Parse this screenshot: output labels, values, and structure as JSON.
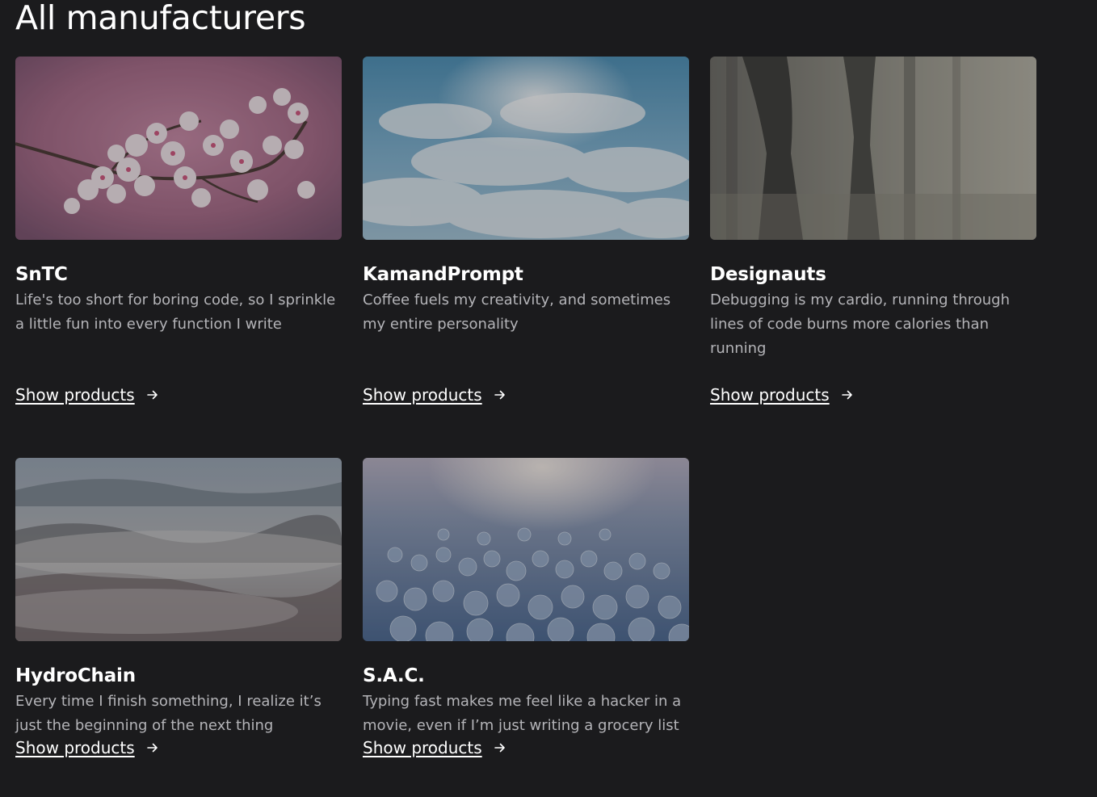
{
  "page": {
    "title": "All manufacturers"
  },
  "manufacturers": [
    {
      "name": "SnTC",
      "description": "Life's too short for boring code, so I sprinkle a little fun into every function I write",
      "link_label": "Show products",
      "image": "cherry-blossom-photo"
    },
    {
      "name": "KamandPrompt",
      "description": "Coffee fuels my creativity, and sometimes my entire personality",
      "link_label": "Show products",
      "image": "sky-clouds-photo"
    },
    {
      "name": "Designauts",
      "description": "Debugging is my cardio, running through lines of code burns more calories than running",
      "link_label": "Show products",
      "image": "foggy-forest-photo"
    },
    {
      "name": "HydroChain",
      "description": "Every time I finish something, I realize it’s just the beginning of the next thing",
      "link_label": "Show products",
      "image": "misty-valley-photo"
    },
    {
      "name": "S.A.C.",
      "description": "Typing fast makes me feel like a hacker in a movie, even if I’m just writing a grocery list",
      "link_label": "Show products",
      "image": "water-beads-photo"
    }
  ],
  "colors": {
    "background": "#1b1b1d",
    "text_primary": "#ffffff",
    "text_secondary": "#b4b4b8"
  }
}
